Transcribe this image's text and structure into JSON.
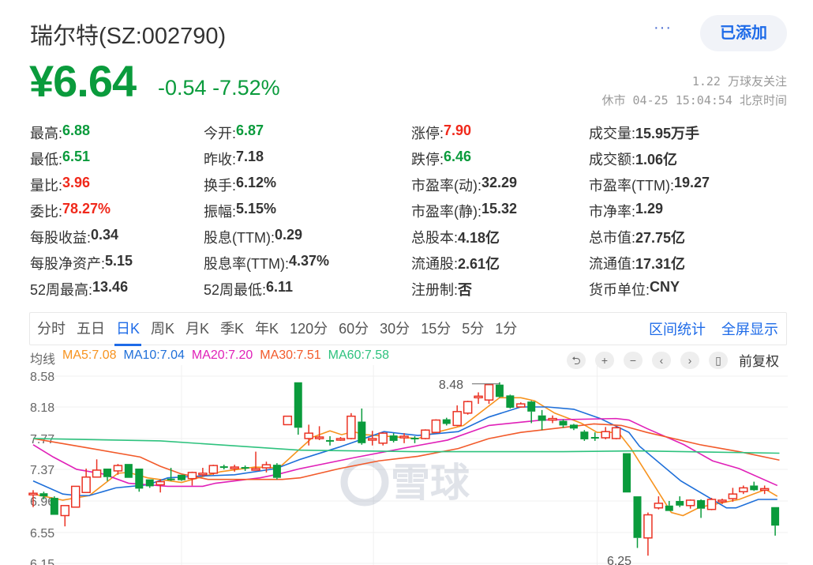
{
  "header": {
    "title": "瑞尔特(SZ:002790)",
    "more_label": "···",
    "add_button": "已添加",
    "price": "¥6.64",
    "change": "-0.54",
    "change_pct": "-7.52%",
    "followers": "1.22 万球友关注",
    "status": "休市 04-25 15:04:54 北京时间"
  },
  "stats": [
    [
      {
        "label": "最高:",
        "value": "6.88",
        "color": "green"
      },
      {
        "label": "今开:",
        "value": "6.87",
        "color": "green"
      },
      {
        "label": "涨停:",
        "value": "7.90",
        "color": "red"
      },
      {
        "label": "成交量:",
        "value": "15.95万手",
        "color": ""
      }
    ],
    [
      {
        "label": "最低:",
        "value": "6.51",
        "color": "green"
      },
      {
        "label": "昨收:",
        "value": "7.18",
        "color": ""
      },
      {
        "label": "跌停:",
        "value": "6.46",
        "color": "green"
      },
      {
        "label": "成交额:",
        "value": "1.06亿",
        "color": ""
      }
    ],
    [
      {
        "label": "量比:",
        "value": "3.96",
        "color": "red"
      },
      {
        "label": "换手:",
        "value": "6.12%",
        "color": ""
      },
      {
        "label": "市盈率(动):",
        "value": "32.29",
        "color": ""
      },
      {
        "label": "市盈率(TTM):",
        "value": "19.27",
        "color": ""
      }
    ],
    [
      {
        "label": "委比:",
        "value": "78.27%",
        "color": "red"
      },
      {
        "label": "振幅:",
        "value": "5.15%",
        "color": ""
      },
      {
        "label": "市盈率(静):",
        "value": "15.32",
        "color": ""
      },
      {
        "label": "市净率:",
        "value": "1.29",
        "color": ""
      }
    ],
    [
      {
        "label": "每股收益:",
        "value": "0.34",
        "color": ""
      },
      {
        "label": "股息(TTM):",
        "value": "0.29",
        "color": ""
      },
      {
        "label": "总股本:",
        "value": "4.18亿",
        "color": ""
      },
      {
        "label": "总市值:",
        "value": "27.75亿",
        "color": ""
      }
    ],
    [
      {
        "label": "每股净资产:",
        "value": "5.15",
        "color": ""
      },
      {
        "label": "股息率(TTM):",
        "value": "4.37%",
        "color": ""
      },
      {
        "label": "流通股:",
        "value": "2.61亿",
        "color": ""
      },
      {
        "label": "流通值:",
        "value": "17.31亿",
        "color": ""
      }
    ],
    [
      {
        "label": "52周最高:",
        "value": "13.46",
        "color": ""
      },
      {
        "label": "52周最低:",
        "value": "6.11",
        "color": ""
      },
      {
        "label": "注册制:",
        "value": "否",
        "color": ""
      },
      {
        "label": "货币单位:",
        "value": "CNY",
        "color": ""
      }
    ]
  ],
  "tabs": [
    "分时",
    "五日",
    "日K",
    "周K",
    "月K",
    "季K",
    "年K",
    "120分",
    "60分",
    "30分",
    "15分",
    "5分",
    "1分"
  ],
  "active_tab": "日K",
  "tab_links": [
    "区间统计",
    "全屏显示"
  ],
  "ma_label": "均线",
  "ma": [
    {
      "text": "MA5:7.08",
      "color": "#f7931e"
    },
    {
      "text": "MA10:7.04",
      "color": "#1e6fd9"
    },
    {
      "text": "MA20:7.20",
      "color": "#e020b8"
    },
    {
      "text": "MA30:7.51",
      "color": "#f25a2a"
    },
    {
      "text": "MA60:7.58",
      "color": "#2ec27e"
    }
  ],
  "controls": {
    "icons": [
      "undo-icon",
      "zoom-in-icon",
      "zoom-out-icon",
      "chevron-left-icon",
      "chevron-right-icon",
      "candle-icon"
    ],
    "glyphs": [
      "⮌",
      "+",
      "−",
      "‹",
      "›",
      "▯"
    ],
    "adjust": "前复权"
  },
  "watermark": "雪球",
  "chart_data": {
    "type": "candlestick",
    "y_ticks": [
      "8.58",
      "8.18",
      "7.77",
      "7.37",
      "6.96",
      "6.55",
      "6.15"
    ],
    "ylim": [
      6.15,
      8.58
    ],
    "max_label": "8.48",
    "max_index": 44,
    "min_label": "6.25",
    "min_index": 58,
    "colors": {
      "up": "#eb3223",
      "down": "#0a9b3c"
    },
    "ohlc": [
      [
        7.06,
        7.06,
        7.1,
        6.88
      ],
      [
        7.06,
        7.02,
        7.08,
        6.98
      ],
      [
        7.0,
        6.78,
        7.02,
        6.78
      ],
      [
        6.77,
        6.9,
        6.9,
        6.63
      ],
      [
        6.88,
        7.15,
        7.15,
        6.88
      ],
      [
        7.07,
        7.27,
        7.38,
        7.07
      ],
      [
        7.27,
        7.36,
        7.5,
        7.27
      ],
      [
        7.38,
        7.27,
        7.38,
        7.22
      ],
      [
        7.35,
        7.42,
        7.44,
        7.3
      ],
      [
        7.44,
        7.26,
        7.44,
        7.26
      ],
      [
        7.38,
        7.12,
        7.38,
        7.08
      ],
      [
        7.24,
        7.15,
        7.24,
        7.13
      ],
      [
        7.17,
        7.21,
        7.24,
        7.07
      ],
      [
        7.25,
        7.24,
        7.39,
        7.22
      ],
      [
        7.3,
        7.23,
        7.3,
        7.22
      ],
      [
        7.25,
        7.33,
        7.34,
        7.16
      ],
      [
        7.31,
        7.32,
        7.39,
        7.28
      ],
      [
        7.32,
        7.42,
        7.43,
        7.3
      ],
      [
        7.41,
        7.4,
        7.43,
        7.37
      ],
      [
        7.39,
        7.4,
        7.43,
        7.34
      ],
      [
        7.4,
        7.39,
        7.42,
        7.35
      ],
      [
        7.37,
        7.38,
        7.6,
        7.36
      ],
      [
        7.39,
        7.43,
        7.47,
        7.33
      ],
      [
        7.43,
        7.26,
        7.45,
        7.24
      ],
      [
        7.95,
        8.06,
        8.06,
        7.95
      ],
      [
        8.5,
        7.91,
        8.5,
        7.82
      ],
      [
        7.77,
        7.84,
        7.95,
        7.68
      ],
      [
        7.78,
        7.79,
        7.93,
        7.75
      ],
      [
        7.75,
        7.74,
        7.8,
        7.68
      ],
      [
        7.76,
        7.77,
        7.79,
        7.74
      ],
      [
        7.77,
        8.06,
        8.1,
        7.76
      ],
      [
        7.99,
        7.71,
        8.16,
        7.69
      ],
      [
        7.76,
        7.77,
        7.87,
        7.68
      ],
      [
        7.71,
        7.84,
        7.85,
        7.68
      ],
      [
        7.81,
        7.74,
        7.84,
        7.72
      ],
      [
        7.79,
        7.8,
        7.84,
        7.71
      ],
      [
        7.78,
        7.77,
        7.8,
        7.71
      ],
      [
        7.77,
        7.88,
        7.89,
        7.76
      ],
      [
        7.85,
        8.01,
        8.02,
        7.84
      ],
      [
        8.02,
        7.96,
        8.04,
        7.94
      ],
      [
        7.94,
        8.12,
        8.2,
        7.93
      ],
      [
        8.1,
        8.25,
        8.26,
        8.08
      ],
      [
        8.31,
        8.32,
        8.37,
        8.22
      ],
      [
        8.27,
        8.47,
        8.48,
        8.22
      ],
      [
        8.47,
        8.31,
        8.5,
        8.3
      ],
      [
        8.33,
        8.17,
        8.34,
        8.16
      ],
      [
        8.18,
        8.22,
        8.24,
        8.17
      ],
      [
        8.25,
        8.12,
        8.26,
        7.97
      ],
      [
        8.07,
        8.0,
        8.14,
        7.88
      ],
      [
        8.02,
        8.03,
        8.07,
        7.97
      ],
      [
        8.0,
        7.94,
        8.02,
        7.91
      ],
      [
        7.95,
        7.9,
        7.96,
        7.88
      ],
      [
        7.86,
        7.76,
        7.88,
        7.74
      ],
      [
        7.79,
        7.78,
        7.85,
        7.74
      ],
      [
        7.78,
        7.86,
        7.92,
        7.76
      ],
      [
        7.77,
        7.91,
        7.93,
        7.76
      ],
      [
        7.58,
        7.07,
        7.58,
        7.07
      ],
      [
        7.02,
        6.48,
        7.02,
        6.35
      ],
      [
        6.48,
        6.78,
        6.81,
        6.25
      ],
      [
        6.87,
        6.93,
        7.02,
        6.85
      ],
      [
        6.9,
        6.83,
        6.96,
        6.83
      ],
      [
        6.96,
        6.9,
        7.02,
        6.88
      ],
      [
        6.9,
        6.97,
        6.98,
        6.86
      ],
      [
        6.97,
        6.86,
        6.98,
        6.74
      ],
      [
        6.85,
        6.98,
        7.0,
        6.84
      ],
      [
        6.97,
        6.97,
        6.99,
        6.92
      ],
      [
        6.99,
        7.05,
        7.13,
        6.95
      ],
      [
        7.08,
        7.13,
        7.16,
        7.05
      ],
      [
        7.16,
        7.1,
        7.21,
        7.09
      ],
      [
        7.11,
        7.12,
        7.16,
        7.05
      ],
      [
        6.88,
        6.64,
        6.88,
        6.51
      ]
    ],
    "month_breaks": [
      14,
      32.1,
      53.2
    ],
    "ma_lines": {
      "MA5": [
        [
          0,
          7.05
        ],
        [
          2.8,
          6.97
        ],
        [
          5.3,
          7.03
        ],
        [
          8,
          7.32
        ],
        [
          9,
          7.33
        ],
        [
          10.8,
          7.26
        ],
        [
          14,
          7.2
        ],
        [
          17.7,
          7.34
        ],
        [
          20.9,
          7.4
        ],
        [
          23.2,
          7.39
        ],
        [
          26.4,
          7.79
        ],
        [
          28,
          7.87
        ],
        [
          29.1,
          7.82
        ],
        [
          30.2,
          7.86
        ],
        [
          31.3,
          7.82
        ],
        [
          36.3,
          7.77
        ],
        [
          38,
          7.85
        ],
        [
          40.6,
          7.94
        ],
        [
          44,
          8.3
        ],
        [
          46,
          8.3
        ],
        [
          47.3,
          8.26
        ],
        [
          49.2,
          8.1
        ],
        [
          51.7,
          7.97
        ],
        [
          53.2,
          7.85
        ],
        [
          55.2,
          7.85
        ],
        [
          56.4,
          7.64
        ],
        [
          60.2,
          6.81
        ],
        [
          61.3,
          6.77
        ],
        [
          62.9,
          6.88
        ],
        [
          66.6,
          6.98
        ],
        [
          69.1,
          7.11
        ],
        [
          70.2,
          7.02
        ]
      ],
      "MA10": [
        [
          0,
          7.22
        ],
        [
          2.8,
          7.05
        ],
        [
          4.1,
          7.03
        ],
        [
          5.3,
          7.03
        ],
        [
          7.8,
          7.13
        ],
        [
          10.8,
          7.17
        ],
        [
          12.7,
          7.26
        ],
        [
          15.3,
          7.28
        ],
        [
          19,
          7.3
        ],
        [
          22.9,
          7.38
        ],
        [
          25.2,
          7.5
        ],
        [
          28.9,
          7.66
        ],
        [
          33.1,
          7.86
        ],
        [
          36.3,
          7.81
        ],
        [
          40.1,
          7.86
        ],
        [
          43,
          8.05
        ],
        [
          46,
          8.18
        ],
        [
          48.5,
          8.18
        ],
        [
          51,
          8.15
        ],
        [
          53.5,
          8.03
        ],
        [
          56.2,
          7.85
        ],
        [
          57.2,
          7.67
        ],
        [
          61.1,
          7.22
        ],
        [
          65.4,
          6.87
        ],
        [
          66.3,
          6.87
        ],
        [
          68.4,
          6.98
        ],
        [
          70.2,
          6.98
        ]
      ],
      "MA20": [
        [
          0,
          7.69
        ],
        [
          1.9,
          7.53
        ],
        [
          4.1,
          7.37
        ],
        [
          6.6,
          7.31
        ],
        [
          9,
          7.19
        ],
        [
          12.7,
          7.15
        ],
        [
          16,
          7.15
        ],
        [
          17.2,
          7.19
        ],
        [
          21.4,
          7.26
        ],
        [
          23.2,
          7.31
        ],
        [
          25.2,
          7.38
        ],
        [
          30.2,
          7.52
        ],
        [
          36.3,
          7.68
        ],
        [
          39.1,
          7.75
        ],
        [
          43,
          7.94
        ],
        [
          48,
          8.01
        ],
        [
          55,
          8.03
        ],
        [
          56.2,
          8.01
        ],
        [
          57.9,
          7.9
        ],
        [
          61.4,
          7.69
        ],
        [
          64.1,
          7.48
        ],
        [
          66.6,
          7.38
        ],
        [
          70.2,
          7.16
        ]
      ],
      "MA30": [
        [
          0,
          7.77
        ],
        [
          5.1,
          7.65
        ],
        [
          10.1,
          7.53
        ],
        [
          12,
          7.41
        ],
        [
          14,
          7.31
        ],
        [
          16.5,
          7.24
        ],
        [
          23.5,
          7.24
        ],
        [
          25.2,
          7.26
        ],
        [
          28.9,
          7.38
        ],
        [
          32.6,
          7.48
        ],
        [
          36.3,
          7.54
        ],
        [
          40.1,
          7.64
        ],
        [
          43,
          7.77
        ],
        [
          46,
          7.85
        ],
        [
          48.5,
          7.89
        ],
        [
          52.9,
          7.96
        ],
        [
          55.5,
          7.94
        ],
        [
          57.9,
          7.85
        ],
        [
          62.9,
          7.69
        ],
        [
          66.6,
          7.6
        ],
        [
          70.4,
          7.49
        ]
      ],
      "MA60": [
        [
          0,
          7.77
        ],
        [
          12,
          7.74
        ],
        [
          25,
          7.62
        ],
        [
          36,
          7.6
        ],
        [
          50,
          7.6
        ],
        [
          57,
          7.61
        ],
        [
          70.4,
          7.58
        ]
      ]
    }
  }
}
